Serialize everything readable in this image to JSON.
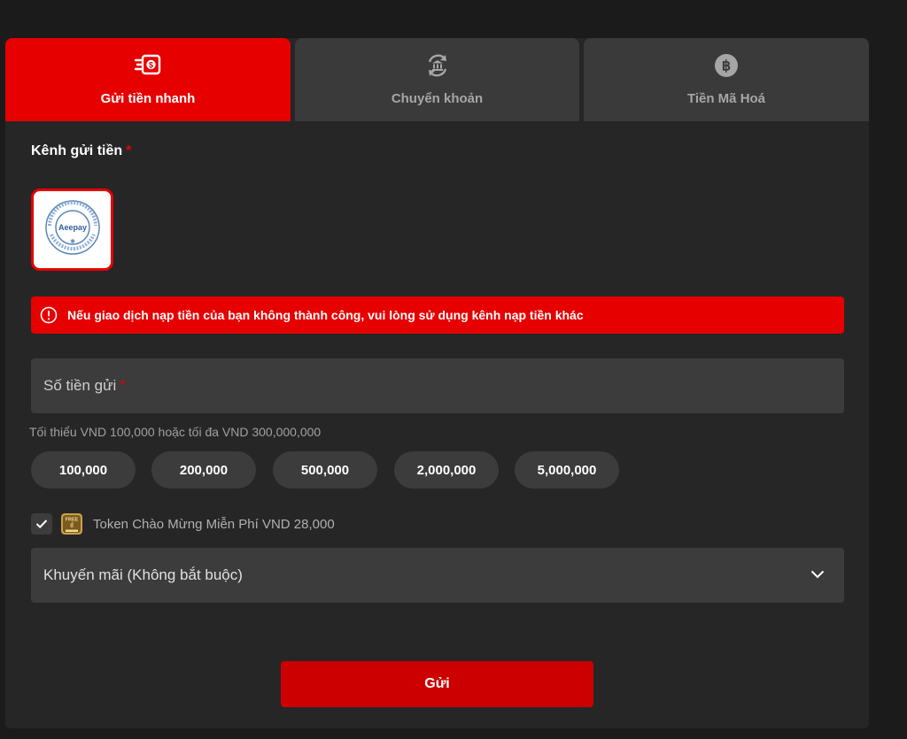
{
  "tabs": [
    {
      "label": "Gửi tiền nhanh",
      "icon": "fast-money-icon",
      "active": true
    },
    {
      "label": "Chuyển khoản",
      "icon": "bank-transfer-icon",
      "active": false
    },
    {
      "label": "Tiền Mã Hoá",
      "icon": "bitcoin-icon",
      "active": false
    }
  ],
  "channel": {
    "label": "Kênh gửi tiền",
    "required_mark": "*",
    "logo_text": "Aeepay",
    "logo_ring_text": "Aee Technology Services Co.,Ltd",
    "selected": true
  },
  "alert": {
    "icon": "alert-circle-icon",
    "text": "Nếu giao dịch nạp tiền của bạn không thành công, vui lòng sử dụng kênh nạp tiền khác"
  },
  "amount": {
    "placeholder": "Số tiền gửi",
    "required_mark": "*",
    "limit_text": "Tối thiểu VND 100,000 hoặc tối đa VND 300,000,000",
    "presets": [
      "100,000",
      "200,000",
      "500,000",
      "2,000,000",
      "5,000,000"
    ]
  },
  "bonus": {
    "checked": true,
    "icon": "free-token-icon",
    "text": "Token Chào Mừng Miễn Phí VND 28,000"
  },
  "promo": {
    "label": "Khuyến mãi (Không bắt buộc)",
    "icon": "chevron-down-icon"
  },
  "submit": {
    "label": "Gửi"
  },
  "colors": {
    "accent": "#e60000",
    "button": "#cc0000",
    "panel": "#262626",
    "input": "#3c3c3c",
    "background": "#1b1b1b"
  }
}
